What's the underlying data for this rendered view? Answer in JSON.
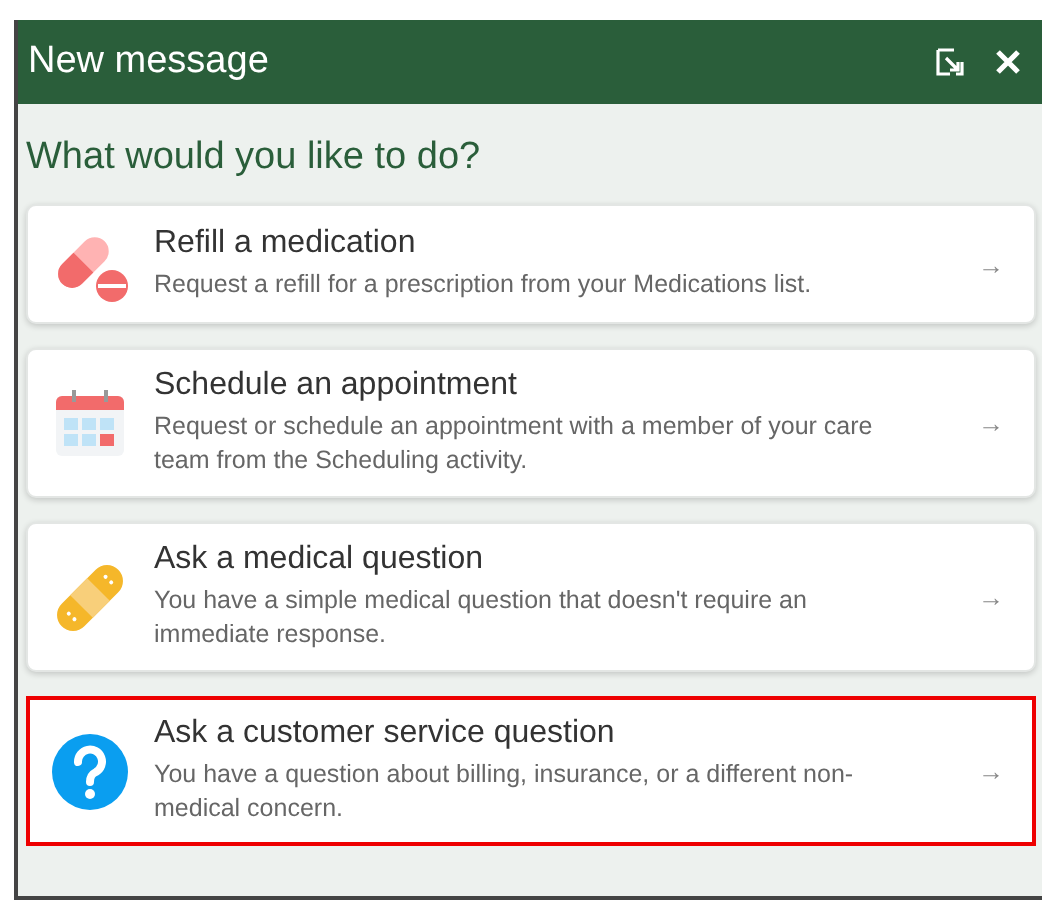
{
  "window": {
    "title": "New message"
  },
  "heading": "What would you like to do?",
  "options": [
    {
      "kind": "pill",
      "title": "Refill a medication",
      "description": "Request a refill for a prescription from your Medications list.",
      "arrow": "→",
      "selected": false
    },
    {
      "kind": "calendar",
      "title": "Schedule an appointment",
      "description": "Request or schedule an appointment with a member of your care team from the Scheduling activity.",
      "arrow": "→",
      "selected": false
    },
    {
      "kind": "bandage",
      "title": "Ask a medical question",
      "description": "You have a simple medical question that doesn't require an immediate response.",
      "arrow": "→",
      "selected": false
    },
    {
      "kind": "question",
      "title": "Ask a customer service question",
      "description": "You have a question about billing, insurance, or a different non-medical concern.",
      "arrow": "→",
      "selected": true
    }
  ]
}
